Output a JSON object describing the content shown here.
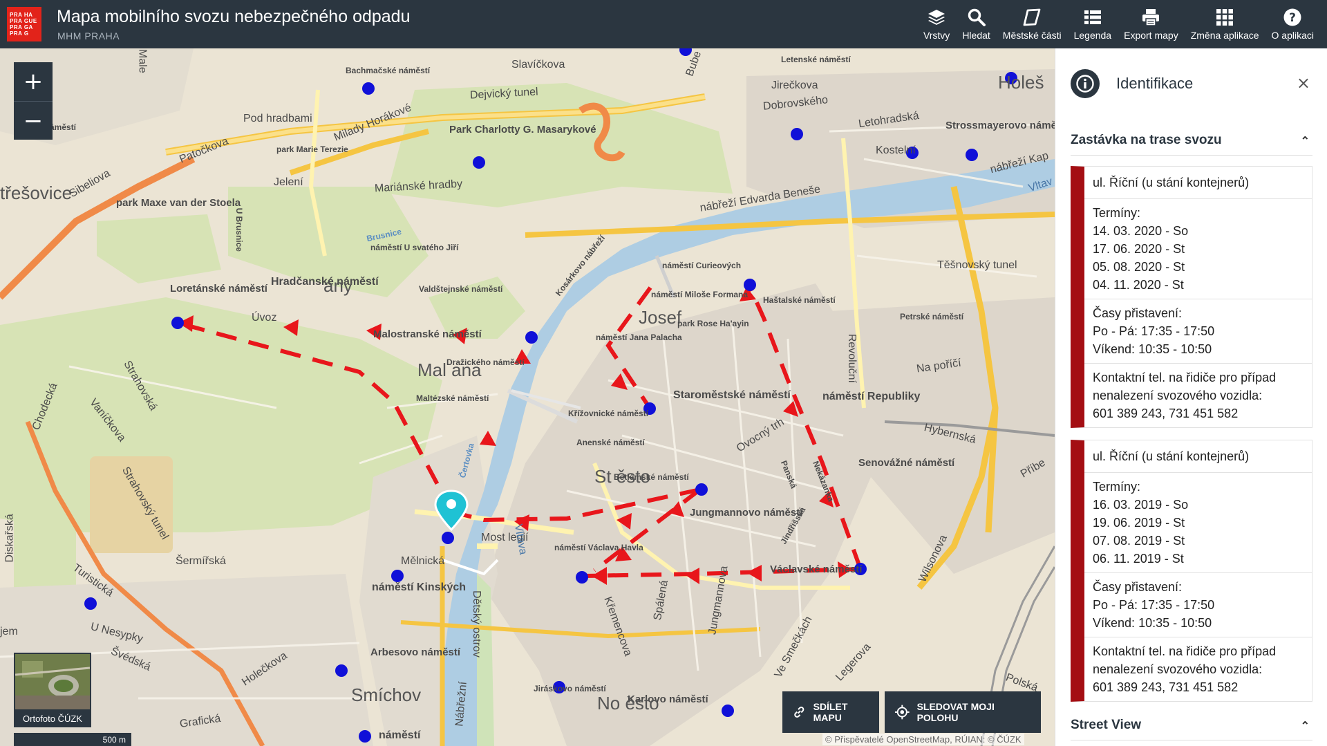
{
  "header": {
    "logo_lines": [
      "PRA HA",
      "PRA GUE",
      "PRA GA",
      "PRA G"
    ],
    "title": "Mapa mobilního svozu nebezpečného odpadu",
    "subtitle": "MHM PRAHA",
    "tools": [
      {
        "label": "Vrstvy",
        "icon": "layers-icon"
      },
      {
        "label": "Hledat",
        "icon": "search-icon"
      },
      {
        "label": "Městské části",
        "icon": "districts-icon"
      },
      {
        "label": "Legenda",
        "icon": "legend-icon"
      },
      {
        "label": "Export mapy",
        "icon": "print-icon"
      },
      {
        "label": "Změna aplikace",
        "icon": "grid-icon"
      },
      {
        "label": "O aplikaci",
        "icon": "help-icon"
      }
    ]
  },
  "map": {
    "zoom_in": "+",
    "zoom_out": "−",
    "ortho_label": "Ortofoto ČÚZK",
    "scale_label": "500 m",
    "share_label": "SDÍLET MAPU",
    "locate_label": "SLEDOVAT MOJI POLOHU",
    "attribution": "© Přispěvatelé OpenStreetMap, RÚIAN: © ČÚZK",
    "labels": {
      "bachmacke": "Bachmačské náměstí",
      "slavickova": "Slavíčkova",
      "dejvicky": "Dejvický tunel",
      "letenske": "Letenské náměstí",
      "jireckova": "Jirečkova",
      "dobrovskeho": "Dobrovského",
      "letohradska": "Letohradská",
      "strossmayerovo": "Strossmayerovo náměstí",
      "kostelni": "Kostelní",
      "pod_hradbami": "Pod hradbami",
      "milady": "Milady Horákové",
      "park_charlotty": "Park Charlotty G. Masarykové",
      "patockova": "Patočkova",
      "park_marie": "park Marie Terezie",
      "stresovice": "třešovice",
      "sibeliova": "Sibeliova",
      "jeleni": "Jelení",
      "marianske": "Mariánské hradby",
      "nabrezi_benese": "nábřeží Edvarda Beneše",
      "park_maxe": "park Maxe van der Stoela",
      "u_brusnice": "U Brusnice",
      "brusnice": "Brusnice",
      "u_svateho_jiri": "náměstí U svatého Jiří",
      "kosarkovo": "Kosárkovo nábřeží",
      "curieovych": "náměstí Curieových",
      "tesnovsky": "Těšnovský tunel",
      "loretanske": "Loretánské náměstí",
      "hradcanske": "Hradčanské náměstí",
      "hradcany": "any",
      "valdstejnske": "Valdštejnské náměstí",
      "milose_formana": "náměstí Miloše Formana",
      "hastalske": "Haštalské náměstí",
      "petrske": "Petrské náměstí",
      "josefov": "Josef",
      "park_rose": "park Rose Ha'ayin",
      "uvoz": "Úvoz",
      "malostranske": "Malostranské náměstí",
      "mala_strana": "Mal ana",
      "drazickeho": "Dražického náměstí",
      "jana_palacha": "náměstí Jana Palacha",
      "revolucni": "Revoluční",
      "na_porici": "Na poříčí",
      "strahovska": "Strahovská",
      "vanickova": "Vaníčkova",
      "chodecka": "Chodecká",
      "maltezske": "Maltézské náměstí",
      "staromestske": "Staroměstské náměstí",
      "namesti_republiky": "náměstí Republiky",
      "krizovnicke": "Křížovnické náměstí",
      "ovocny": "Ovocný trh",
      "hybernska": "Hybernská",
      "anenske": "Anenské náměstí",
      "senovazne": "Senovážné náměstí",
      "certovka": "Čertovka",
      "diskarska": "Diskařská",
      "stare_mesto": "St     ěsto",
      "betlemske": "Betlémské náměstí",
      "panska": "Panská",
      "nekazanka": "Nekázanka",
      "jungmannovo": "Jungmannovo náměstí",
      "jindrisska": "Jindřišská",
      "most_legii": "Most legií",
      "vltava": "Vltava",
      "strahovsky_tunel": "Strahovský tunel",
      "sermirska": "Šermířská",
      "melnicka": "Mělnická",
      "vaclava_havla": "náměstí Václava Havla",
      "vaclavske": "Václavské náměstí",
      "wilsonova": "Wilsonova",
      "turisticka": "Turistická",
      "kinskych": "náměstí Kinských",
      "detsky_ostrov": "Dětský ostrov",
      "kremencova": "Křemencova",
      "spalena": "Spálená",
      "jungmannova": "Jungmannova",
      "u_nesypky": "U Nesypky",
      "svedska": "Švédská",
      "holeckova": "Holečkova",
      "arbesovo": "Arbesovo náměstí",
      "ve_smeckach": "Ve Smečkách",
      "legerova": "Legerova",
      "smichov": "Smíchov",
      "nabrezni": "Nábřežní",
      "jiraskovo": "Jiráskovo náměstí",
      "karlovo": "Karlovo náměstí",
      "nove_mesto": "No      ěsto",
      "graficka": "Grafická",
      "namesti_bottom": "náměstí",
      "polska": "Polská",
      "pribenicka": "Příbe",
      "ovo": "ovo náměstí",
      "jem": "jem",
      "male": "Male",
      "bube": "Bube",
      "holes": "Holeš",
      "vltav_right": "Vltav",
      "nabr_kap": "nábřeží Kap"
    }
  },
  "panel": {
    "title": "Identifikace",
    "close": "×",
    "section_title": "Zastávka na trase svozu",
    "section_chevron": "⌃",
    "cards": [
      {
        "name": "ul. Říční (u stání kontejnerů)",
        "terms_label": "Termíny:",
        "terms": [
          "14. 03. 2020 - So",
          "17. 06. 2020 - St",
          "05. 08. 2020 - St",
          "04. 11. 2020 - St"
        ],
        "times_label": "Časy přistavení:",
        "weekday_label": "Po - Pá:",
        "weekday_time": "17:35 - 17:50",
        "weekend_label": "Víkend:",
        "weekend_time": "10:35 - 10:50",
        "contact_label": "Kontaktní tel. na řidiče pro případ nenalezení svozového vozidla:",
        "contact_phones": "601 389 243, 731 451 582"
      },
      {
        "name": "ul. Říční (u stání kontejnerů)",
        "terms_label": "Termíny:",
        "terms": [
          "16. 03. 2019 - So",
          "19. 06. 2019 - St",
          "07. 08. 2019 - St",
          "06. 11. 2019 - St"
        ],
        "times_label": "Časy přistavení:",
        "weekday_label": "Po - Pá:",
        "weekday_time": "17:35 - 17:50",
        "weekend_label": "Víkend:",
        "weekend_time": "10:35 - 10:50",
        "contact_label": "Kontaktní tel. na řidiče pro případ nenalezení svozového vozidla:",
        "contact_phones": "601 389 243, 731 451 582"
      }
    ],
    "street_view_title": "Street View",
    "street_view_chevron": "⌃"
  },
  "colors": {
    "header_bg": "#2b3640",
    "accent_red": "#a40e13",
    "route_red": "#e8161b",
    "stop_blue": "#1010d8",
    "marker_cyan": "#1fc2d4",
    "river": "#aecde3"
  }
}
